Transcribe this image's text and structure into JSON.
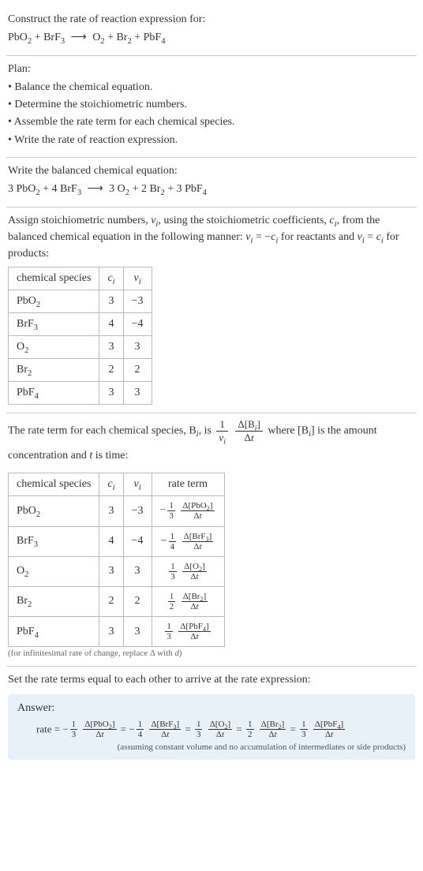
{
  "intro": {
    "construct": "Construct the rate of reaction expression for:",
    "eq_lhs1": "PbO",
    "eq_lhs1_sub": "2",
    "plus": " + ",
    "eq_lhs2": "BrF",
    "eq_lhs2_sub": "3",
    "arrow": "⟶",
    "eq_rhs1": "O",
    "eq_rhs1_sub": "2",
    "eq_rhs2": "Br",
    "eq_rhs2_sub": "2",
    "eq_rhs3": "PbF",
    "eq_rhs3_sub": "4"
  },
  "plan": {
    "title": "Plan:",
    "b1": "• Balance the chemical equation.",
    "b2": "• Determine the stoichiometric numbers.",
    "b3": "• Assemble the rate term for each chemical species.",
    "b4": "• Write the rate of reaction expression."
  },
  "balanced": {
    "title": "Write the balanced chemical equation:",
    "c1": "3 PbO",
    "c1s": "2",
    "c2": " + 4 BrF",
    "c2s": "3",
    "arrow": "⟶",
    "c3": " 3 O",
    "c3s": "2",
    "c4": " + 2 Br",
    "c4s": "2",
    "c5": " + 3 PbF",
    "c5s": "4"
  },
  "assign": {
    "text1": "Assign stoichiometric numbers, ",
    "nu": "ν",
    "i": "i",
    "text2": ", using the stoichiometric coefficients, ",
    "c": "c",
    "text3": ", from the balanced chemical equation in the following manner: ",
    "eq1": " = −",
    "text4": " for reactants and ",
    "eq2": " = ",
    "text5": " for products:",
    "th1": "chemical species",
    "th2_c": "c",
    "th2_i": "i",
    "th3_nu": "ν",
    "th3_i": "i",
    "rows": [
      {
        "sp": "PbO",
        "sub": "2",
        "c": "3",
        "nu": "−3"
      },
      {
        "sp": "BrF",
        "sub": "3",
        "c": "4",
        "nu": "−4"
      },
      {
        "sp": "O",
        "sub": "2",
        "c": "3",
        "nu": "3"
      },
      {
        "sp": "Br",
        "sub": "2",
        "c": "2",
        "nu": "2"
      },
      {
        "sp": "PbF",
        "sub": "4",
        "c": "3",
        "nu": "3"
      }
    ]
  },
  "rateterm": {
    "text1": "The rate term for each chemical species, B",
    "text2": ", is ",
    "frac1_num": "1",
    "frac1_den_nu": "ν",
    "frac1_den_i": "i",
    "frac2_num": "Δ[B",
    "frac2_num_i": "i",
    "frac2_num_close": "]",
    "frac2_den": "Δt",
    "text3": " where [B",
    "text4": "] is the amount concentration and ",
    "t": "t",
    "text5": " is time:",
    "th1": "chemical species",
    "th2_c": "c",
    "th2_i": "i",
    "th3_nu": "ν",
    "th3_i": "i",
    "th4": "rate term",
    "rows": [
      {
        "sp": "PbO",
        "sub": "2",
        "c": "3",
        "nu": "−3",
        "sign": "−",
        "fn": "1",
        "fd": "3",
        "dnum": "Δ[PbO",
        "dsub": "2",
        "dclose": "]",
        "dden": "Δt"
      },
      {
        "sp": "BrF",
        "sub": "3",
        "c": "4",
        "nu": "−4",
        "sign": "−",
        "fn": "1",
        "fd": "4",
        "dnum": "Δ[BrF",
        "dsub": "3",
        "dclose": "]",
        "dden": "Δt"
      },
      {
        "sp": "O",
        "sub": "2",
        "c": "3",
        "nu": "3",
        "sign": "",
        "fn": "1",
        "fd": "3",
        "dnum": "Δ[O",
        "dsub": "2",
        "dclose": "]",
        "dden": "Δt"
      },
      {
        "sp": "Br",
        "sub": "2",
        "c": "2",
        "nu": "2",
        "sign": "",
        "fn": "1",
        "fd": "2",
        "dnum": "Δ[Br",
        "dsub": "2",
        "dclose": "]",
        "dden": "Δt"
      },
      {
        "sp": "PbF",
        "sub": "4",
        "c": "3",
        "nu": "3",
        "sign": "",
        "fn": "1",
        "fd": "3",
        "dnum": "Δ[PbF",
        "dsub": "4",
        "dclose": "]",
        "dden": "Δt"
      }
    ],
    "note": "(for infinitesimal rate of change, replace Δ with d)"
  },
  "final": {
    "title": "Set the rate terms equal to each other to arrive at the rate expression:",
    "answer": "Answer:",
    "rate_label": "rate = ",
    "terms": [
      {
        "sign": "−",
        "fn": "1",
        "fd": "3",
        "dnum": "Δ[PbO",
        "dsub": "2",
        "dclose": "]",
        "dden": "Δt"
      },
      {
        "sign": "−",
        "fn": "1",
        "fd": "4",
        "dnum": "Δ[BrF",
        "dsub": "3",
        "dclose": "]",
        "dden": "Δt"
      },
      {
        "sign": "",
        "fn": "1",
        "fd": "3",
        "dnum": "Δ[O",
        "dsub": "2",
        "dclose": "]",
        "dden": "Δt"
      },
      {
        "sign": "",
        "fn": "1",
        "fd": "2",
        "dnum": "Δ[Br",
        "dsub": "2",
        "dclose": "]",
        "dden": "Δt"
      },
      {
        "sign": "",
        "fn": "1",
        "fd": "3",
        "dnum": "Δ[PbF",
        "dsub": "4",
        "dclose": "]",
        "dden": "Δt"
      }
    ],
    "eq": " = ",
    "note": "(assuming constant volume and no accumulation of intermediates or side products)"
  }
}
